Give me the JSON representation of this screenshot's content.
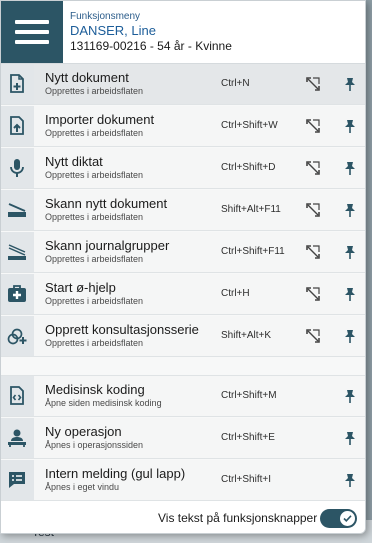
{
  "header": {
    "menu_title": "Funksjonsmeny",
    "patient_name": "DANSER, Line",
    "patient_info": "131169-00216 - 54 år - Kvinne"
  },
  "items_group1": [
    {
      "label": "Nytt dokument",
      "sub": "Opprettes i arbeidsflaten",
      "shortcut": "Ctrl+N",
      "icon": "add-document-icon"
    },
    {
      "label": "Importer dokument",
      "sub": "Opprettes i arbeidsflaten",
      "shortcut": "Ctrl+Shift+W",
      "icon": "import-document-icon"
    },
    {
      "label": "Nytt diktat",
      "sub": "Opprettes i arbeidsflaten",
      "shortcut": "Ctrl+Shift+D",
      "icon": "microphone-icon"
    },
    {
      "label": "Skann nytt dokument",
      "sub": "Opprettes i arbeidsflaten",
      "shortcut": "Shift+Alt+F11",
      "icon": "scanner-icon"
    },
    {
      "label": "Skann journalgrupper",
      "sub": "Opprettes i arbeidsflaten",
      "shortcut": "Ctrl+Shift+F11",
      "icon": "scanner-stack-icon"
    },
    {
      "label": "Start ø-hjelp",
      "sub": "Opprettes i arbeidsflaten",
      "shortcut": "Ctrl+H",
      "icon": "first-aid-kit-icon"
    },
    {
      "label": "Opprett konsultasjonsserie",
      "sub": "Opprettes i arbeidsflaten",
      "shortcut": "Shift+Alt+K",
      "icon": "consultation-series-icon"
    }
  ],
  "items_group2": [
    {
      "label": "Medisinsk koding",
      "sub": "Åpne siden medisinsk koding",
      "shortcut": "Ctrl+Shift+M",
      "icon": "code-document-icon"
    },
    {
      "label": "Ny operasjon",
      "sub": "Åpnes i operasjonssiden",
      "shortcut": "Ctrl+Shift+E",
      "icon": "surgery-icon"
    },
    {
      "label": "Intern melding (gul lapp)",
      "sub": "Åpnes i eget vindu",
      "shortcut": "Ctrl+Shift+I",
      "icon": "message-icon"
    }
  ],
  "footer": {
    "toggle_label": "Vis tekst på funksjonsknapper",
    "toggle_on": true
  },
  "background": {
    "peek_text": "Test"
  },
  "colors": {
    "accent": "#2c5565",
    "link": "#1c5d99",
    "icon": "#2c5565"
  }
}
